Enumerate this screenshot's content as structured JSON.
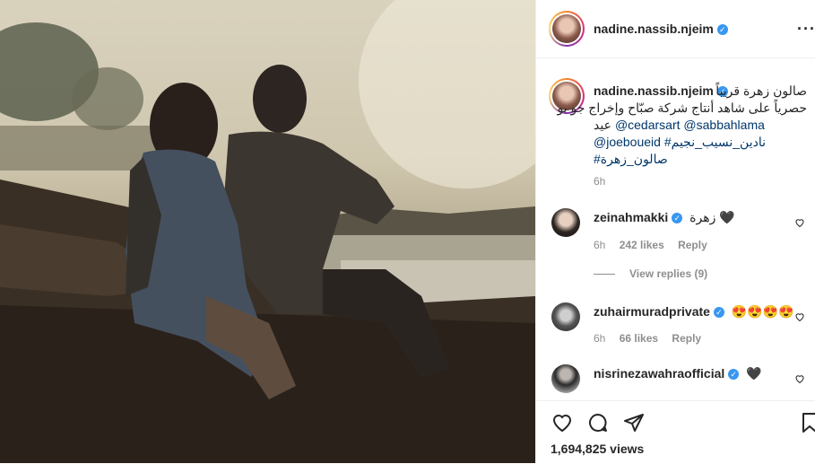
{
  "post": {
    "username": "nadine.nassib.njeim",
    "more_label": "···"
  },
  "caption": {
    "username": "nadine.nassib.njeim",
    "line1": "صالون زهرة قريباً",
    "line2": "حصرياً على شاهد أنتاج شركة صبّاح وإخراج جو بو",
    "line3_rtl": "عيد",
    "mention1": "@cedarsart",
    "mention2": "@sabbahlama",
    "mention3": "@joeboueid",
    "hashtag1": "#نادين_نسيب_نجيم",
    "hashtag2": "#صالون_زهرة",
    "time": "6h"
  },
  "comments": [
    {
      "username": "zeinahmakki",
      "text": "زهرة 🖤",
      "time": "6h",
      "likes": "242 likes",
      "reply": "Reply",
      "view_replies": "View replies (9)"
    },
    {
      "username": "zuhairmuradprivate",
      "text": "😍😍😍😍",
      "time": "6h",
      "likes": "66 likes",
      "reply": "Reply"
    },
    {
      "username": "nisrinezawahraofficial",
      "text": "🖤"
    }
  ],
  "footer": {
    "views": "1,694,825 views"
  },
  "colors": {
    "verified": "#3897f0",
    "link": "#00376b",
    "muted": "#8e8e8e"
  }
}
